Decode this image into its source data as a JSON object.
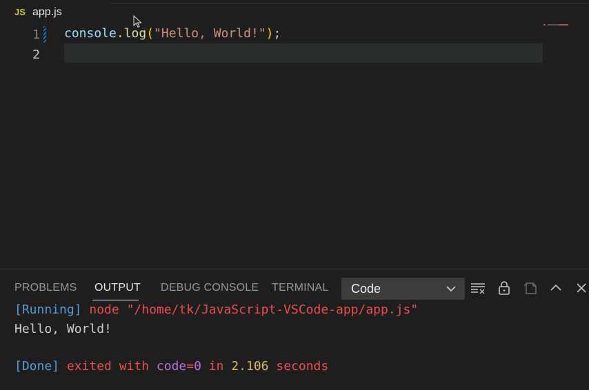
{
  "editor_tab": {
    "icon_text": "JS",
    "filename": "app.js"
  },
  "editor": {
    "line_numbers": [
      "1",
      "2"
    ],
    "code": {
      "object": "console",
      "dot": ".",
      "method": "log",
      "open_paren": "(",
      "string": "\"Hello, World!\"",
      "close_paren": ")",
      "semicolon": ";"
    }
  },
  "panel": {
    "tabs": [
      "PROBLEMS",
      "OUTPUT",
      "DEBUG CONSOLE",
      "TERMINAL"
    ],
    "active_tab": "OUTPUT",
    "channel_select": "Code",
    "actions": [
      "clear-output-icon",
      "lock-icon",
      "open-editor-icon",
      "maximize-panel-icon",
      "close-panel-icon"
    ],
    "output": {
      "line1": {
        "tag": "[Running]",
        "cmd": " node \"/home/tk/JavaScript-VSCode-app/app.js\""
      },
      "line2": "Hello, World!",
      "line3": {
        "tag": "[Done]",
        "exited": " exited with ",
        "code_kw": "code",
        "eq": "=",
        "code_val": "0",
        "in": " in ",
        "secs_val": "2.106",
        "seconds": " seconds"
      }
    }
  },
  "colors": {
    "editor_bg": "#1e1e1e",
    "js_icon": "#cbcb41",
    "string": "#ce9178",
    "variable": "#9cdcfe",
    "function": "#dcdcaa",
    "bracket": "#ffd700"
  }
}
